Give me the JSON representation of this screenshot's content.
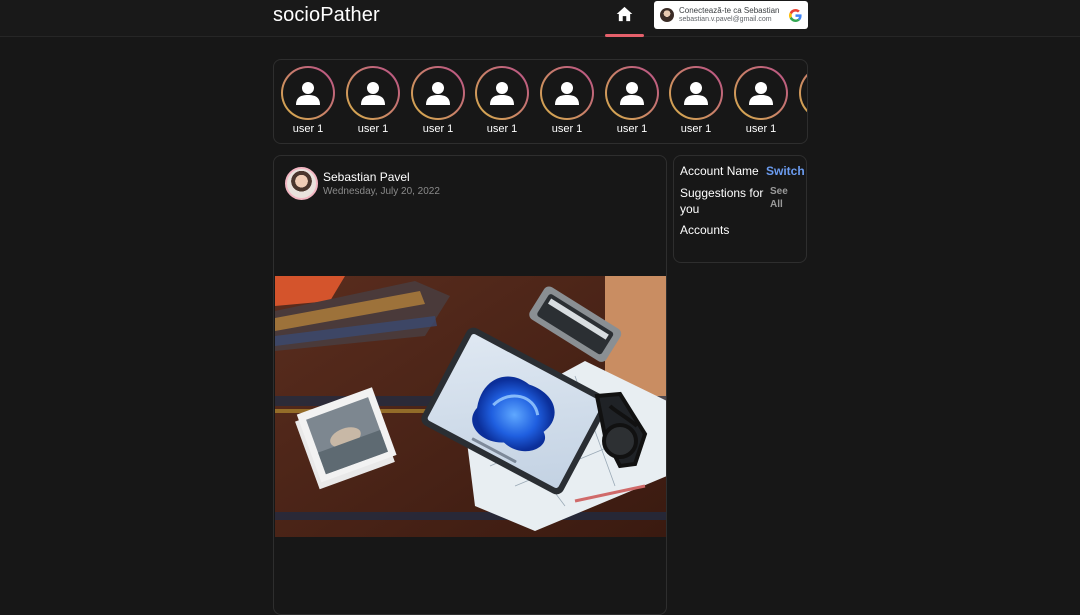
{
  "header": {
    "logo": "socioPather",
    "home_icon": "home-icon",
    "google": {
      "title": "Conectează-te ca Sebastian",
      "email": "sebastian.v.pavel@gmail.com",
      "icon": "google-g-icon"
    }
  },
  "stories": [
    {
      "label": "user 1",
      "icon": "user-icon"
    },
    {
      "label": "user 1",
      "icon": "user-icon"
    },
    {
      "label": "user 1",
      "icon": "user-icon"
    },
    {
      "label": "user 1",
      "icon": "user-icon"
    },
    {
      "label": "user 1",
      "icon": "user-icon"
    },
    {
      "label": "user 1",
      "icon": "user-icon"
    },
    {
      "label": "user 1",
      "icon": "user-icon"
    },
    {
      "label": "user 1",
      "icon": "user-icon"
    }
  ],
  "post": {
    "author": "Sebastian Pavel",
    "date": "Wednesday, July 20, 2022"
  },
  "sidebar": {
    "account_name": "Account Name",
    "switch": "Switch",
    "suggestions": "Suggestions for you",
    "see_all": "See All",
    "accounts": "Accounts"
  },
  "colors": {
    "background": "#171717",
    "accent": "#e5606b",
    "link": "#6b9cf0",
    "story_ring_start": "#d8b24a",
    "story_ring_end": "#b94d8a"
  }
}
